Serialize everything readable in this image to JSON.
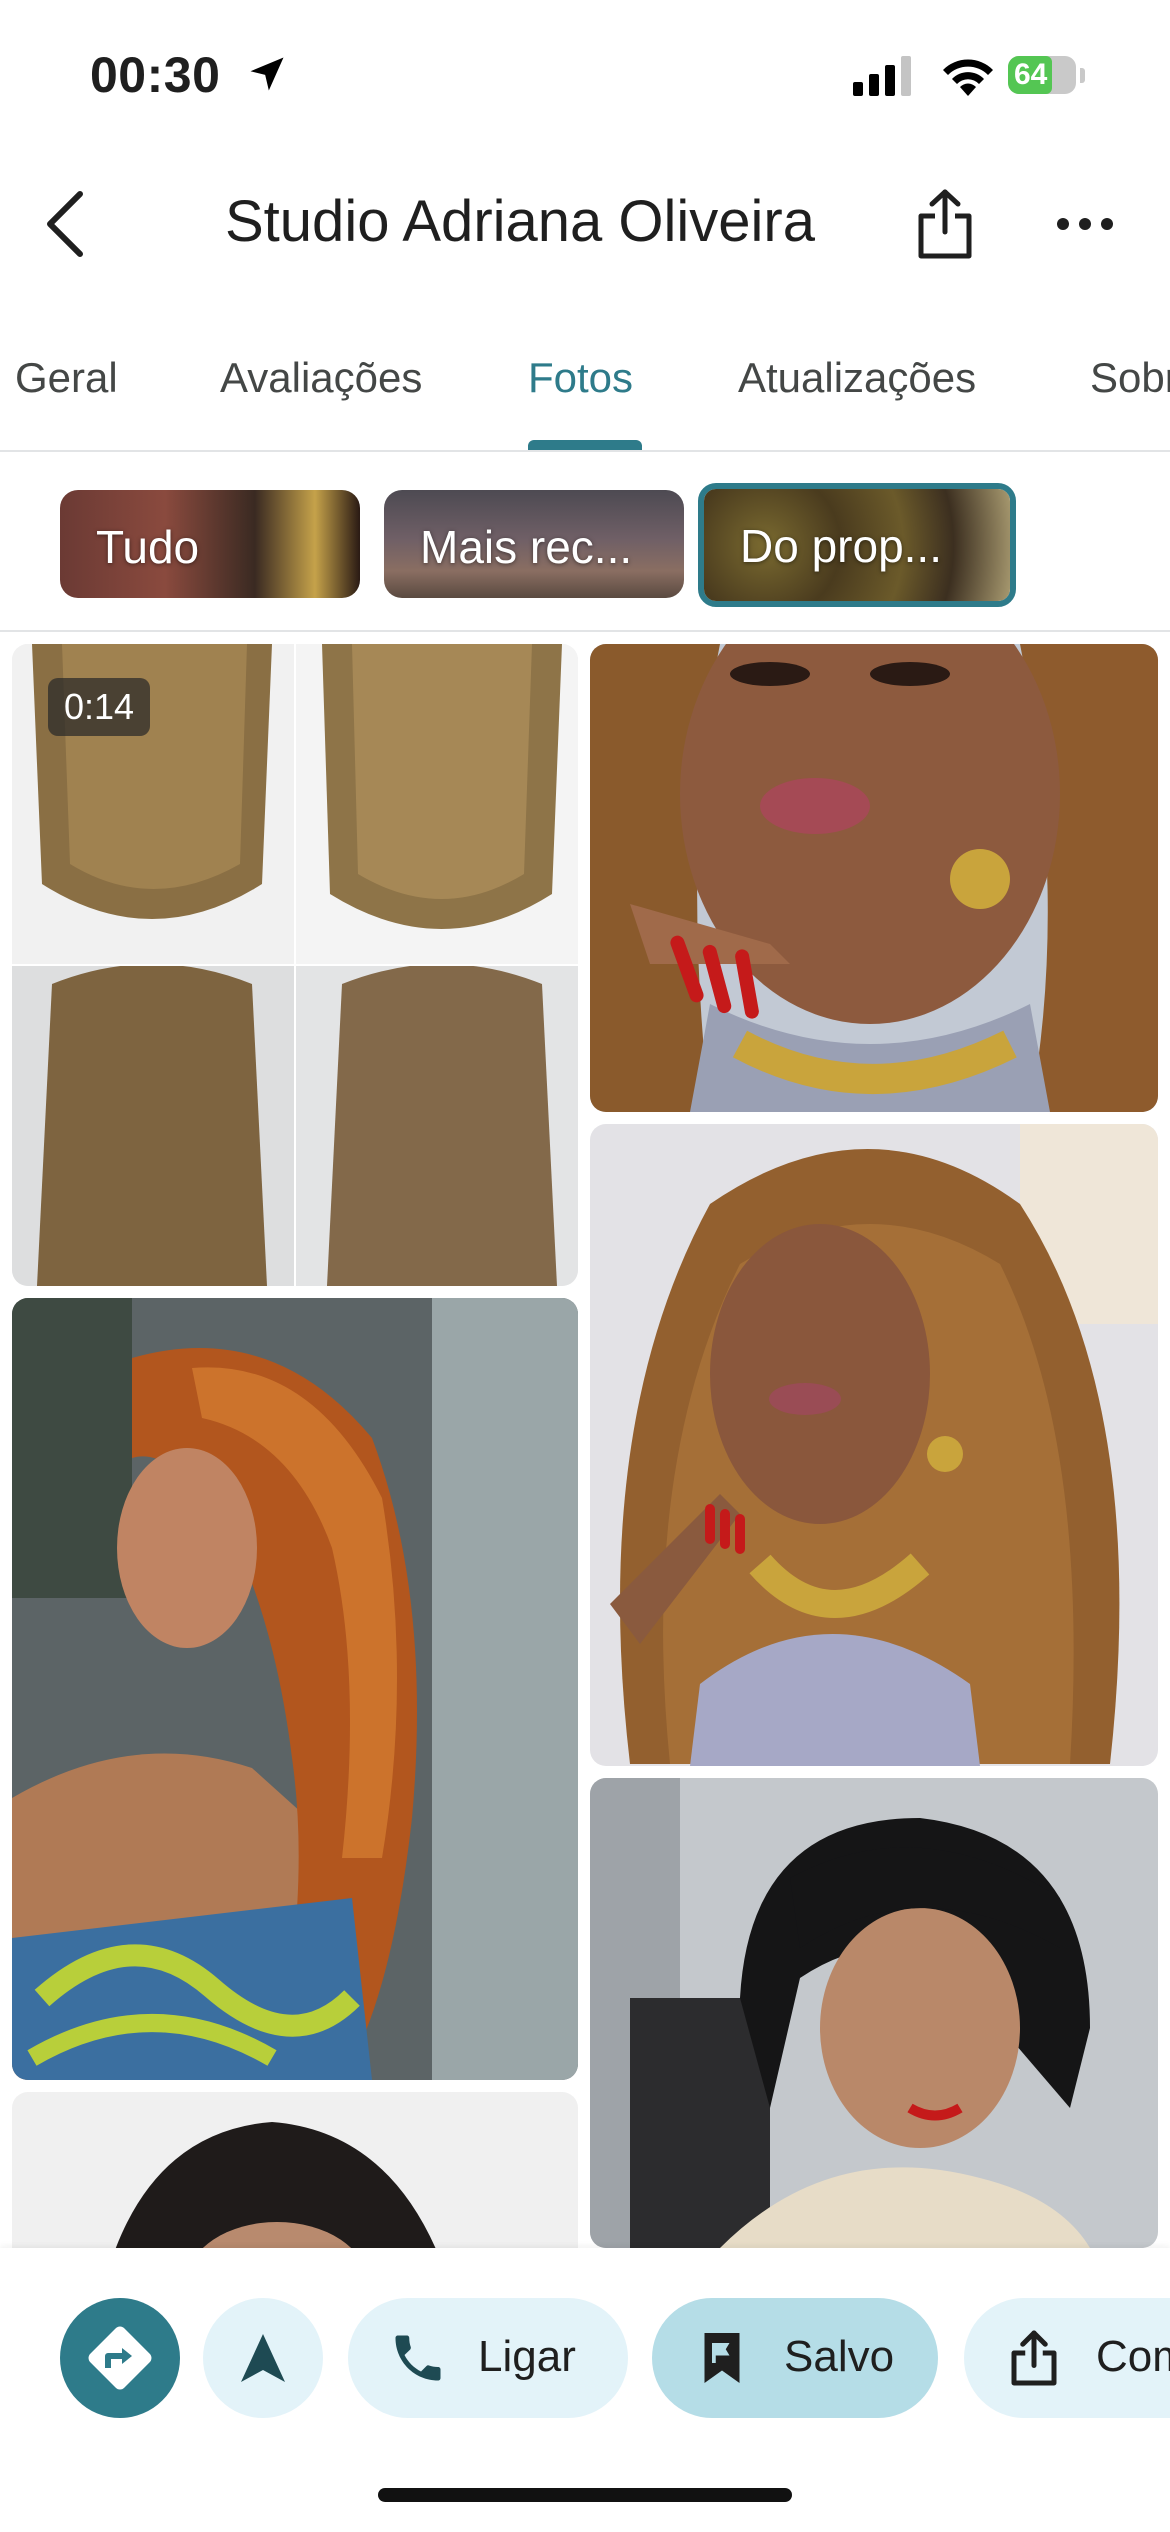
{
  "status_bar": {
    "time": "00:30",
    "battery": "64"
  },
  "header": {
    "title": "Studio Adriana Oliveira"
  },
  "tabs": [
    {
      "label": "Geral"
    },
    {
      "label": "Avaliações"
    },
    {
      "label": "Fotos"
    },
    {
      "label": "Atualizações"
    },
    {
      "label": "Sobre"
    }
  ],
  "active_tab": "Fotos",
  "filters": [
    {
      "label": "Tudo"
    },
    {
      "label": "Mais rec..."
    },
    {
      "label": "Do prop..."
    }
  ],
  "selected_filter": "Do prop...",
  "photos": {
    "video_duration": "0:14"
  },
  "actions": {
    "call_label": "Ligar",
    "saved_label": "Salvo",
    "share_label": "Compartilhar"
  },
  "colors": {
    "accent": "#2e7b8a",
    "chip_light": "#e3f3f9",
    "chip_saved": "#b5dde7"
  },
  "icons": [
    "location-arrow-icon",
    "signal-icon",
    "wifi-icon",
    "battery-icon",
    "back-arrow-icon",
    "share-icon",
    "more-icon",
    "directions-icon",
    "navigate-icon",
    "phone-icon",
    "bookmark-icon"
  ]
}
